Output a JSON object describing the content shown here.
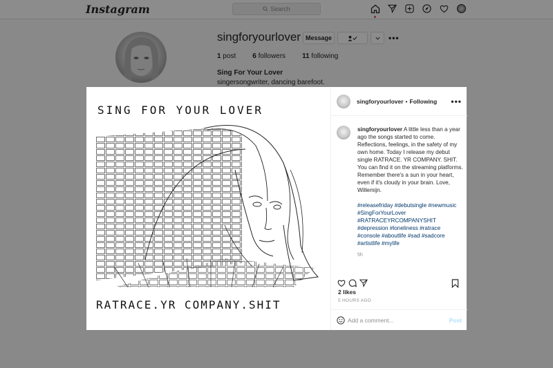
{
  "nav": {
    "logo": "Instagram",
    "search_placeholder": "Search"
  },
  "profile": {
    "username": "singforyourlover",
    "message_label": "Message",
    "posts_count": "1",
    "posts_label": "post",
    "followers_count": "6",
    "followers_label": "followers",
    "following_count": "11",
    "following_label": "following",
    "full_name": "Sing For Your Lover",
    "bio": "singersongwriter, dancing barefoot."
  },
  "post": {
    "art_title": "SING FOR YOUR LOVER",
    "art_bottom": "RATRACE.YR COMPANY.SHIT",
    "header_username": "singforyourlover",
    "header_sep": "•",
    "header_following": "Following",
    "caption_username": "singforyourlover",
    "caption_text": "A little less than a year ago the songs started to come. Reflections, feelings, in the safety of my own home. Today I release my debut single RATRACE. YR COMPANY. SHIT. You can find it on the streaming platforms. Remember there's a sun in your heart, even if it's cloudy in your brain. Love, Willemijn.",
    "hashtags": "#releasefriday #debutsingle #newmusic #SingForYourLover #RATRACEYRCOMPANYSHIT #depression #loneliness #ratrace #console #aboutlife #sad #sadcore #artistlife #mylife",
    "caption_time": "5h",
    "likes": "2 likes",
    "posted_ago": "5 HOURS AGO",
    "comment_placeholder": "Add a comment...",
    "post_label": "Post"
  }
}
